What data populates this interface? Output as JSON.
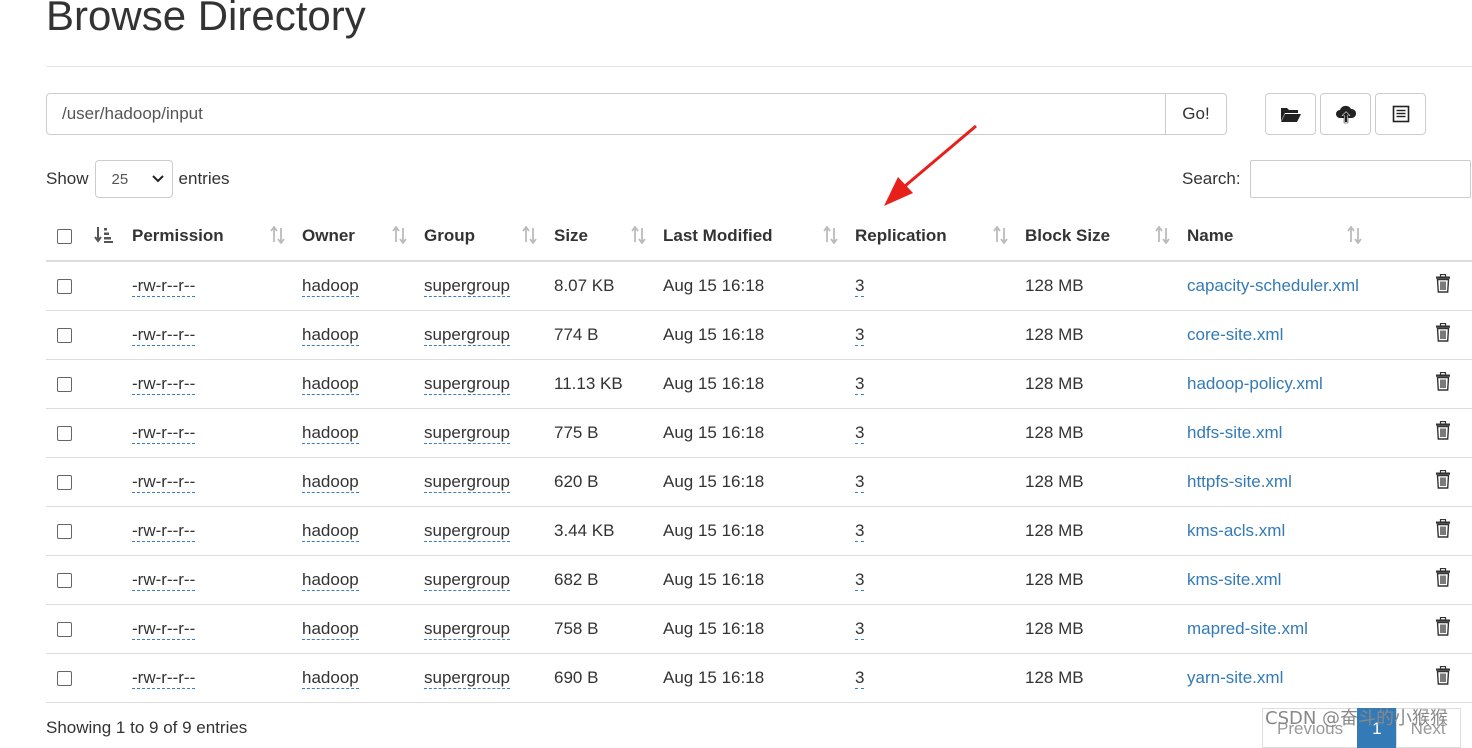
{
  "page": {
    "title": "Browse Directory"
  },
  "path_bar": {
    "value": "/user/hadoop/input",
    "go_label": "Go!"
  },
  "toolbar": {
    "icons": [
      "folder-open-icon",
      "cloud-upload-icon",
      "list-icon"
    ]
  },
  "length": {
    "show_label": "Show",
    "selected": "25",
    "entries_label": "entries"
  },
  "search": {
    "label": "Search:",
    "value": ""
  },
  "table": {
    "columns": [
      "Permission",
      "Owner",
      "Group",
      "Size",
      "Last Modified",
      "Replication",
      "Block Size",
      "Name"
    ],
    "rows": [
      {
        "permission": "-rw-r--r--",
        "owner": "hadoop",
        "group": "supergroup",
        "size": "8.07 KB",
        "modified": "Aug 15 16:18",
        "replication": "3",
        "block_size": "128 MB",
        "name": "capacity-scheduler.xml"
      },
      {
        "permission": "-rw-r--r--",
        "owner": "hadoop",
        "group": "supergroup",
        "size": "774 B",
        "modified": "Aug 15 16:18",
        "replication": "3",
        "block_size": "128 MB",
        "name": "core-site.xml"
      },
      {
        "permission": "-rw-r--r--",
        "owner": "hadoop",
        "group": "supergroup",
        "size": "11.13 KB",
        "modified": "Aug 15 16:18",
        "replication": "3",
        "block_size": "128 MB",
        "name": "hadoop-policy.xml"
      },
      {
        "permission": "-rw-r--r--",
        "owner": "hadoop",
        "group": "supergroup",
        "size": "775 B",
        "modified": "Aug 15 16:18",
        "replication": "3",
        "block_size": "128 MB",
        "name": "hdfs-site.xml"
      },
      {
        "permission": "-rw-r--r--",
        "owner": "hadoop",
        "group": "supergroup",
        "size": "620 B",
        "modified": "Aug 15 16:18",
        "replication": "3",
        "block_size": "128 MB",
        "name": "httpfs-site.xml"
      },
      {
        "permission": "-rw-r--r--",
        "owner": "hadoop",
        "group": "supergroup",
        "size": "3.44 KB",
        "modified": "Aug 15 16:18",
        "replication": "3",
        "block_size": "128 MB",
        "name": "kms-acls.xml"
      },
      {
        "permission": "-rw-r--r--",
        "owner": "hadoop",
        "group": "supergroup",
        "size": "682 B",
        "modified": "Aug 15 16:18",
        "replication": "3",
        "block_size": "128 MB",
        "name": "kms-site.xml"
      },
      {
        "permission": "-rw-r--r--",
        "owner": "hadoop",
        "group": "supergroup",
        "size": "758 B",
        "modified": "Aug 15 16:18",
        "replication": "3",
        "block_size": "128 MB",
        "name": "mapred-site.xml"
      },
      {
        "permission": "-rw-r--r--",
        "owner": "hadoop",
        "group": "supergroup",
        "size": "690 B",
        "modified": "Aug 15 16:18",
        "replication": "3",
        "block_size": "128 MB",
        "name": "yarn-site.xml"
      }
    ]
  },
  "footer": {
    "info": "Showing 1 to 9 of 9 entries"
  },
  "pagination": {
    "previous": "Previous",
    "current": "1",
    "next": "Next"
  },
  "watermark": "CSDN @奋斗的小猴猴",
  "colors": {
    "link": "#337ab7",
    "annotation_arrow": "#e8201c"
  }
}
